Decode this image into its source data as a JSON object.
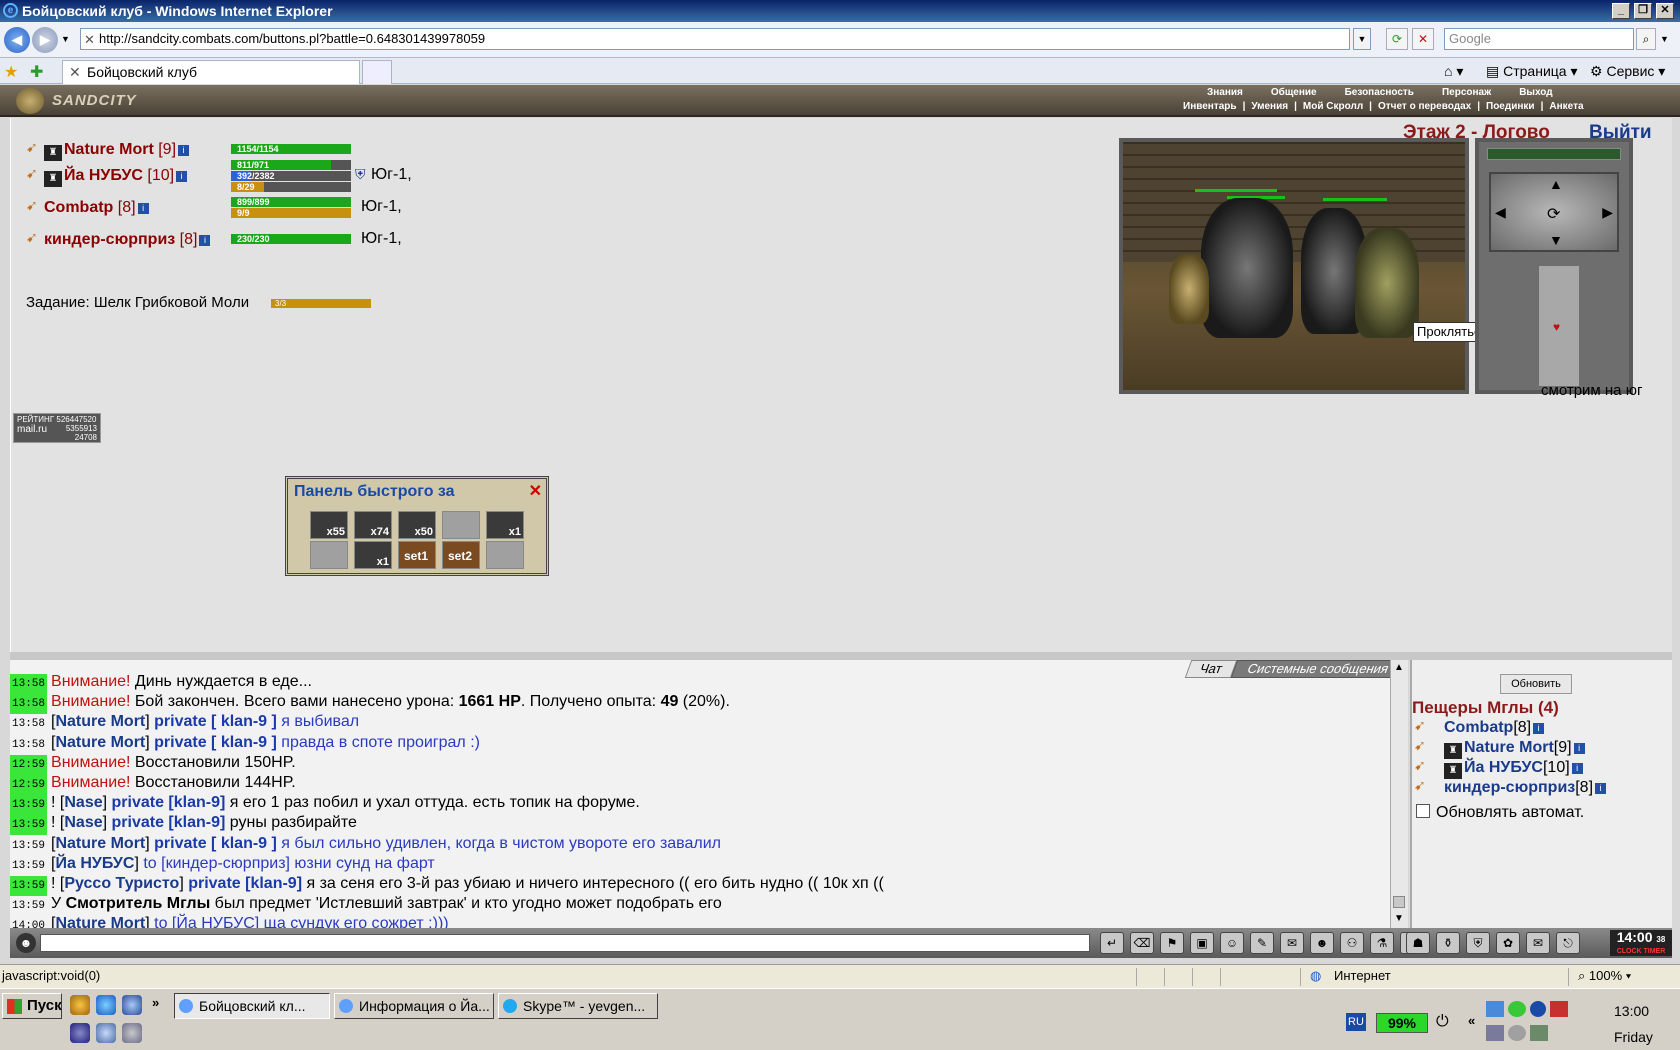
{
  "window": {
    "title": "Бойцовский клуб - Windows Internet Explorer"
  },
  "browser": {
    "url": "http://sandcity.combats.com/buttons.pl?battle=0.648301439978059",
    "search_placeholder": "Google",
    "tab_title": "Бойцовский клуб",
    "cmd_page": "Страница",
    "cmd_service": "Сервис",
    "status_text": "javascript:void(0)",
    "zone": "Интернет",
    "zoom": "100%"
  },
  "game_header": {
    "logo": "SANDCITY",
    "menu_top": [
      "Знания",
      "Общение",
      "Безопасность",
      "Персонаж",
      "Выход"
    ],
    "menu_bottom": [
      "Инвентарь",
      "Умения",
      "Мой Скролл",
      "Отчет о переводах",
      "Поединки",
      "Анкета"
    ]
  },
  "party": [
    {
      "name": "Nature Mort",
      "level": "[9]",
      "bars": [
        {
          "text": "1154/1154",
          "fill": 1.0,
          "color": "#1aa81a"
        }
      ],
      "pos": ""
    },
    {
      "name": "Йа НУБУС",
      "level": "[10]",
      "bars": [
        {
          "text": "811/971",
          "fill": 0.835,
          "color": "#1aa81a"
        },
        {
          "text": "392/2382",
          "fill": 0.165,
          "color": "#2a62d8"
        },
        {
          "text": "8/29",
          "fill": 0.276,
          "color": "#c89010"
        }
      ],
      "pos": "Юг-1,"
    },
    {
      "name": "Combatp",
      "level": "[8]",
      "bars": [
        {
          "text": "899/899",
          "fill": 1.0,
          "color": "#1aa81a"
        },
        {
          "text": "9/9",
          "fill": 1.0,
          "color": "#c89010"
        }
      ],
      "pos": "Юг-1,"
    },
    {
      "name": "киндер-сюрприз",
      "level": "[8]",
      "bars": [
        {
          "text": "230/230",
          "fill": 1.0,
          "color": "#1aa81a"
        }
      ],
      "pos": "Юг-1,"
    }
  ],
  "task": {
    "label": "Задание: Шелк Грибковой Моли",
    "progress": "3/3"
  },
  "location": {
    "floor": "Этаж 2 - Логово",
    "exit": "Выйти",
    "tooltip": "Проклятье Глубин",
    "looking": "смотрим на юг"
  },
  "rating": {
    "line1": "РЕЙТИНГ 526447520",
    "line2": "mail.ru",
    "line3": "5355913",
    "line4": "24708"
  },
  "quick_panel": {
    "title": "Панель быстрого за",
    "slots_row1": [
      "x55",
      "x74",
      "x50",
      "",
      "x1"
    ],
    "slots_row2": [
      "",
      "x1",
      "set1",
      "set2",
      ""
    ]
  },
  "chat_tabs": {
    "chat": "Чат",
    "system": "Системные сообщения"
  },
  "chat": [
    {
      "ts": "13:58",
      "green": true,
      "parts": [
        {
          "c": "warn",
          "t": "Внимание!"
        },
        {
          "c": "",
          "t": " Динь нуждается в еде..."
        }
      ]
    },
    {
      "ts": "13:58",
      "green": true,
      "parts": [
        {
          "c": "warn",
          "t": "Внимание!"
        },
        {
          "c": "",
          "t": " Бой закончен. Всего вами нанесено урона: "
        },
        {
          "c": "b",
          "t": "1661 HP"
        },
        {
          "c": "",
          "t": ". Получено опыта: "
        },
        {
          "c": "b",
          "t": "49"
        },
        {
          "c": "",
          "t": " (20%)."
        }
      ]
    },
    {
      "ts": "13:58",
      "green": false,
      "parts": [
        {
          "c": "",
          "t": "["
        },
        {
          "c": "nick",
          "t": "Nature Mort"
        },
        {
          "c": "",
          "t": "] "
        },
        {
          "c": "priv",
          "t": "private [ klan-9 ]"
        },
        {
          "c": "ptxt",
          "t": " я выбивал"
        }
      ]
    },
    {
      "ts": "13:58",
      "green": false,
      "parts": [
        {
          "c": "",
          "t": "["
        },
        {
          "c": "nick",
          "t": "Nature Mort"
        },
        {
          "c": "",
          "t": "] "
        },
        {
          "c": "priv",
          "t": "private [ klan-9 ]"
        },
        {
          "c": "ptxt",
          "t": " правда в споте проиграл :)"
        }
      ]
    },
    {
      "ts": "12:59",
      "green": true,
      "parts": [
        {
          "c": "warn",
          "t": "Внимание!"
        },
        {
          "c": "",
          "t": " Восстановили 150HP."
        }
      ]
    },
    {
      "ts": "12:59",
      "green": true,
      "parts": [
        {
          "c": "warn",
          "t": "Внимание!"
        },
        {
          "c": "",
          "t": " Восстановили 144HP."
        }
      ]
    },
    {
      "ts": "13:59",
      "green": true,
      "parts": [
        {
          "c": "",
          "t": "! ["
        },
        {
          "c": "nick",
          "t": "Nase"
        },
        {
          "c": "",
          "t": "] "
        },
        {
          "c": "priv",
          "t": "private [klan-9]"
        },
        {
          "c": "",
          "t": " я его 1 раз побил и ухал оттуда. есть топик на форуме."
        }
      ]
    },
    {
      "ts": "13:59",
      "green": true,
      "parts": [
        {
          "c": "",
          "t": "! ["
        },
        {
          "c": "nick",
          "t": "Nase"
        },
        {
          "c": "",
          "t": "] "
        },
        {
          "c": "priv",
          "t": "private [klan-9]"
        },
        {
          "c": "",
          "t": " руны разбирайте"
        }
      ]
    },
    {
      "ts": "13:59",
      "green": false,
      "parts": [
        {
          "c": "",
          "t": "["
        },
        {
          "c": "nick",
          "t": "Nature Mort"
        },
        {
          "c": "",
          "t": "] "
        },
        {
          "c": "priv",
          "t": "private [ klan-9 ]"
        },
        {
          "c": "ptxt",
          "t": " я был сильно удивлен, когда в чистом увороте его завалил"
        }
      ]
    },
    {
      "ts": "13:59",
      "green": false,
      "parts": [
        {
          "c": "",
          "t": "["
        },
        {
          "c": "nick",
          "t": "Йа НУБУС"
        },
        {
          "c": "",
          "t": "] "
        },
        {
          "c": "ptxt",
          "t": "to [киндер-сюрприз] юзни сунд на фарт"
        }
      ]
    },
    {
      "ts": "13:59",
      "green": true,
      "parts": [
        {
          "c": "",
          "t": "! ["
        },
        {
          "c": "nick",
          "t": "Руссо Туристо"
        },
        {
          "c": "",
          "t": "] "
        },
        {
          "c": "priv",
          "t": "private [klan-9]"
        },
        {
          "c": "",
          "t": " я за сеня его 3-й раз убиаю и ничего интересного (( его бить нудно (( 10к хп (("
        }
      ]
    },
    {
      "ts": "13:59",
      "green": false,
      "parts": [
        {
          "c": "",
          "t": "У "
        },
        {
          "c": "b",
          "t": "Смотритель Мглы"
        },
        {
          "c": "",
          "t": " был предмет 'Истлевший завтрак' и кто угодно может подобрать его"
        }
      ]
    },
    {
      "ts": "14:00",
      "green": false,
      "parts": [
        {
          "c": "",
          "t": "["
        },
        {
          "c": "nick",
          "t": "Nature Mort"
        },
        {
          "c": "",
          "t": "] "
        },
        {
          "c": "ptxt",
          "t": "to [Йа НУБУС] ща сундук его сожрет :)))"
        }
      ]
    }
  ],
  "side": {
    "refresh": "Обновить",
    "location": "Пещеры Мглы (4)",
    "players": [
      {
        "name": "Combatp",
        "level": "[8]"
      },
      {
        "name": "Nature Mort",
        "level": "[9]"
      },
      {
        "name": "Йа НУБУС",
        "level": "[10]"
      },
      {
        "name": "киндер-сюрприз",
        "level": "[8]"
      }
    ],
    "auto_refresh": "Обновлять автомат."
  },
  "clock": {
    "time": "14:00",
    "sec": "38",
    "label": "CLOCK TIMER"
  },
  "taskbar": {
    "start": "Пуск",
    "items": [
      "Бойцовский кл...",
      "Информация о Йа...",
      "Skype™ - yevgen..."
    ],
    "lang": "RU",
    "battery": "99%",
    "time": "13:00",
    "day": "Friday"
  }
}
